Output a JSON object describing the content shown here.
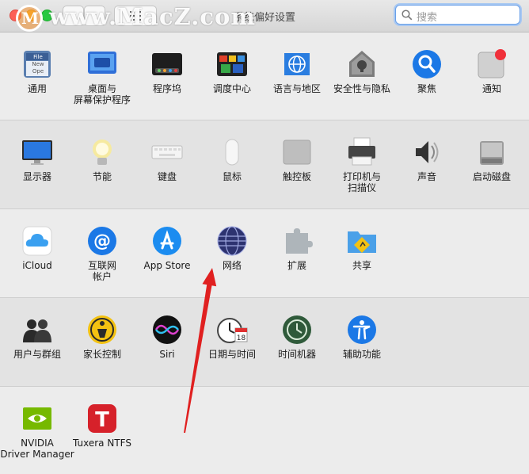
{
  "window": {
    "title": "系统偏好设置"
  },
  "watermark": {
    "text": "www.MacZ.com"
  },
  "search": {
    "placeholder": "搜索"
  },
  "rows": [
    [
      {
        "id": "general",
        "label": "通用",
        "icon": "general-icon",
        "mini": "File\nNew\nOpe"
      },
      {
        "id": "desktop",
        "label": "桌面与\n屏幕保护程序",
        "icon": "desktop-icon"
      },
      {
        "id": "dock",
        "label": "程序坞",
        "icon": "dock-icon"
      },
      {
        "id": "mission",
        "label": "调度中心",
        "icon": "mission-control-icon"
      },
      {
        "id": "language",
        "label": "语言与地区",
        "icon": "language-icon"
      },
      {
        "id": "security",
        "label": "安全性与隐私",
        "icon": "security-icon"
      },
      {
        "id": "spotlight",
        "label": "聚焦",
        "icon": "spotlight-icon"
      },
      {
        "id": "notifications",
        "label": "通知",
        "icon": "notifications-icon"
      }
    ],
    [
      {
        "id": "displays",
        "label": "显示器",
        "icon": "display-icon"
      },
      {
        "id": "energy",
        "label": "节能",
        "icon": "energy-icon"
      },
      {
        "id": "keyboard",
        "label": "键盘",
        "icon": "keyboard-icon"
      },
      {
        "id": "mouse",
        "label": "鼠标",
        "icon": "mouse-icon"
      },
      {
        "id": "trackpad",
        "label": "触控板",
        "icon": "trackpad-icon"
      },
      {
        "id": "printers",
        "label": "打印机与\n扫描仪",
        "icon": "printer-icon"
      },
      {
        "id": "sound",
        "label": "声音",
        "icon": "sound-icon"
      },
      {
        "id": "startup",
        "label": "启动磁盘",
        "icon": "startup-disk-icon"
      }
    ],
    [
      {
        "id": "icloud",
        "label": "iCloud",
        "icon": "icloud-icon"
      },
      {
        "id": "internet",
        "label": "互联网\n帐户",
        "icon": "internet-accounts-icon"
      },
      {
        "id": "appstore",
        "label": "App Store",
        "icon": "appstore-icon"
      },
      {
        "id": "network",
        "label": "网络",
        "icon": "network-icon"
      },
      {
        "id": "extensions",
        "label": "扩展",
        "icon": "extensions-icon"
      },
      {
        "id": "sharing",
        "label": "共享",
        "icon": "sharing-icon"
      }
    ],
    [
      {
        "id": "users",
        "label": "用户与群组",
        "icon": "users-icon"
      },
      {
        "id": "parental",
        "label": "家长控制",
        "icon": "parental-controls-icon"
      },
      {
        "id": "siri",
        "label": "Siri",
        "icon": "siri-icon"
      },
      {
        "id": "datetime",
        "label": "日期与时间",
        "icon": "date-time-icon",
        "cal": "18"
      },
      {
        "id": "timemachine",
        "label": "时间机器",
        "icon": "time-machine-icon"
      },
      {
        "id": "accessibility",
        "label": "辅助功能",
        "icon": "accessibility-icon"
      }
    ],
    [
      {
        "id": "nvidia",
        "label": "NVIDIA\nDriver Manager",
        "icon": "nvidia-icon"
      },
      {
        "id": "tuxera",
        "label": "Tuxera NTFS",
        "icon": "tuxera-icon",
        "glyph": "T"
      }
    ]
  ],
  "colors": {
    "annotation_arrow": "#e02020",
    "accent": "#2d7fe0"
  }
}
